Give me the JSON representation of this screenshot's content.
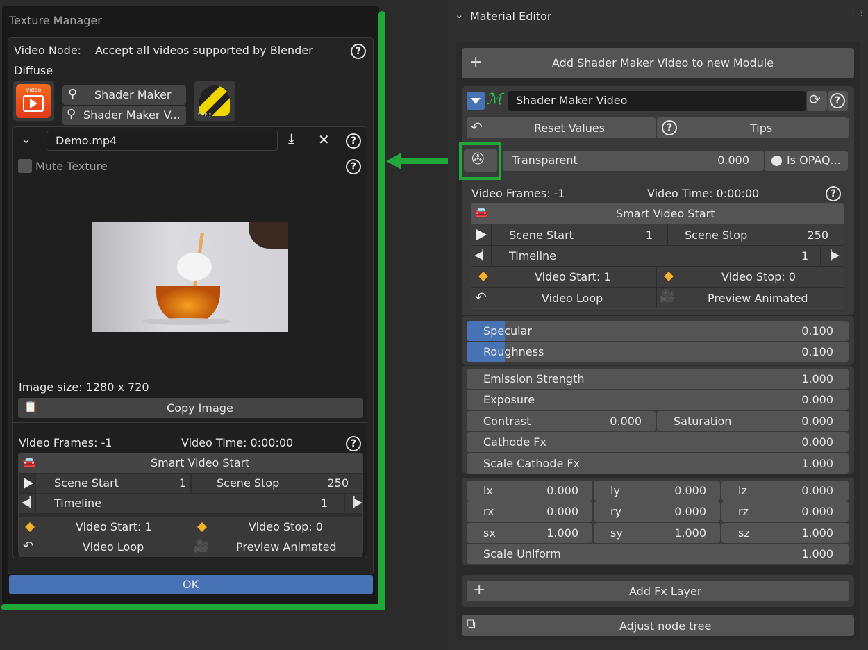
{
  "texture_manager": {
    "title": "Texture Manager",
    "video_node_label": "Video Node:",
    "video_node_value": "Accept all videos supported by Blender",
    "diffuse_label": "Diffuse",
    "video_thumb_label": "Video",
    "shader_maker_btn": "Shader Maker",
    "shader_maker_v_btn": "Shader Maker V...",
    "empty_label": "Empty",
    "file_name": "Demo.mp4",
    "mute_texture": "Mute Texture",
    "image_size": "Image size: 1280 x 720",
    "copy_image": "Copy Image",
    "video_frames": "Video Frames: -1",
    "video_time": "Video Time: 0:00:00",
    "smart_video_start": "Smart Video Start",
    "scene_start_label": "Scene Start",
    "scene_start_value": "1",
    "scene_stop_label": "Scene Stop",
    "scene_stop_value": "250",
    "timeline_label": "Timeline",
    "timeline_value": "1",
    "video_start": "Video Start: 1",
    "video_stop": "Video Stop: 0",
    "video_loop": "Video Loop",
    "preview_animated": "Preview Animated",
    "ok": "OK"
  },
  "material_editor": {
    "title": "Material Editor",
    "add_shader_maker_video": "Add Shader Maker Video to new Module",
    "module_name": "Shader Maker Video",
    "reset_values": "Reset Values",
    "tips": "Tips",
    "transparent_label": "Transparent",
    "transparent_value": "0.000",
    "is_opaque": "Is OPAQ...",
    "video_frames": "Video Frames: -1",
    "video_time": "Video Time: 0:00:00",
    "smart_video_start": "Smart Video Start",
    "scene_start_label": "Scene Start",
    "scene_start_value": "1",
    "scene_stop_label": "Scene Stop",
    "scene_stop_value": "250",
    "timeline_label": "Timeline",
    "timeline_value": "1",
    "video_start": "Video Start: 1",
    "video_stop": "Video Stop: 0",
    "video_loop": "Video Loop",
    "preview_animated": "Preview Animated",
    "specular_label": "Specular",
    "specular_value": "0.100",
    "specular_fill": 0.1,
    "roughness_label": "Roughness",
    "roughness_value": "0.100",
    "roughness_fill": 0.1,
    "emission_strength_label": "Emission Strength",
    "emission_strength_value": "1.000",
    "exposure_label": "Exposure",
    "exposure_value": "0.000",
    "contrast_label": "Contrast",
    "contrast_value": "0.000",
    "saturation_label": "Saturation",
    "saturation_value": "0.000",
    "cathode_fx_label": "Cathode Fx",
    "cathode_fx_value": "0.000",
    "scale_cathode_fx_label": "Scale Cathode Fx",
    "scale_cathode_fx_value": "1.000",
    "lx_label": "lx",
    "lx_value": "0.000",
    "ly_label": "ly",
    "ly_value": "0.000",
    "lz_label": "lz",
    "lz_value": "0.000",
    "rx_label": "rx",
    "rx_value": "0.000",
    "ry_label": "ry",
    "ry_value": "0.000",
    "rz_label": "rz",
    "rz_value": "0.000",
    "sx_label": "sx",
    "sx_value": "1.000",
    "sy_label": "sy",
    "sy_value": "1.000",
    "sz_label": "sz",
    "sz_value": "1.000",
    "scale_uniform_label": "Scale Uniform",
    "scale_uniform_value": "1.000",
    "add_fx_layer": "Add Fx Layer",
    "adjust_node_tree": "Adjust node tree"
  },
  "colors": {
    "highlight_green": "#20a838",
    "ok_blue": "#4772b3",
    "accent_blue": "#4772b3",
    "keyframe_orange": "#f0b030"
  },
  "icons": {
    "help": "help-icon",
    "download": "download-icon",
    "close": "close-icon",
    "chevron": "chevron-down-icon",
    "film_reel": "film-reel-icon",
    "refresh": "refresh-icon",
    "undo": "undo-icon",
    "play": "play-icon",
    "keyframe": "keyframe-icon",
    "camera": "camera-icon",
    "car": "car-icon",
    "plus": "plus-icon",
    "search": "search-icon",
    "clipboard": "clipboard-icon",
    "node_tree": "node-tree-icon"
  }
}
